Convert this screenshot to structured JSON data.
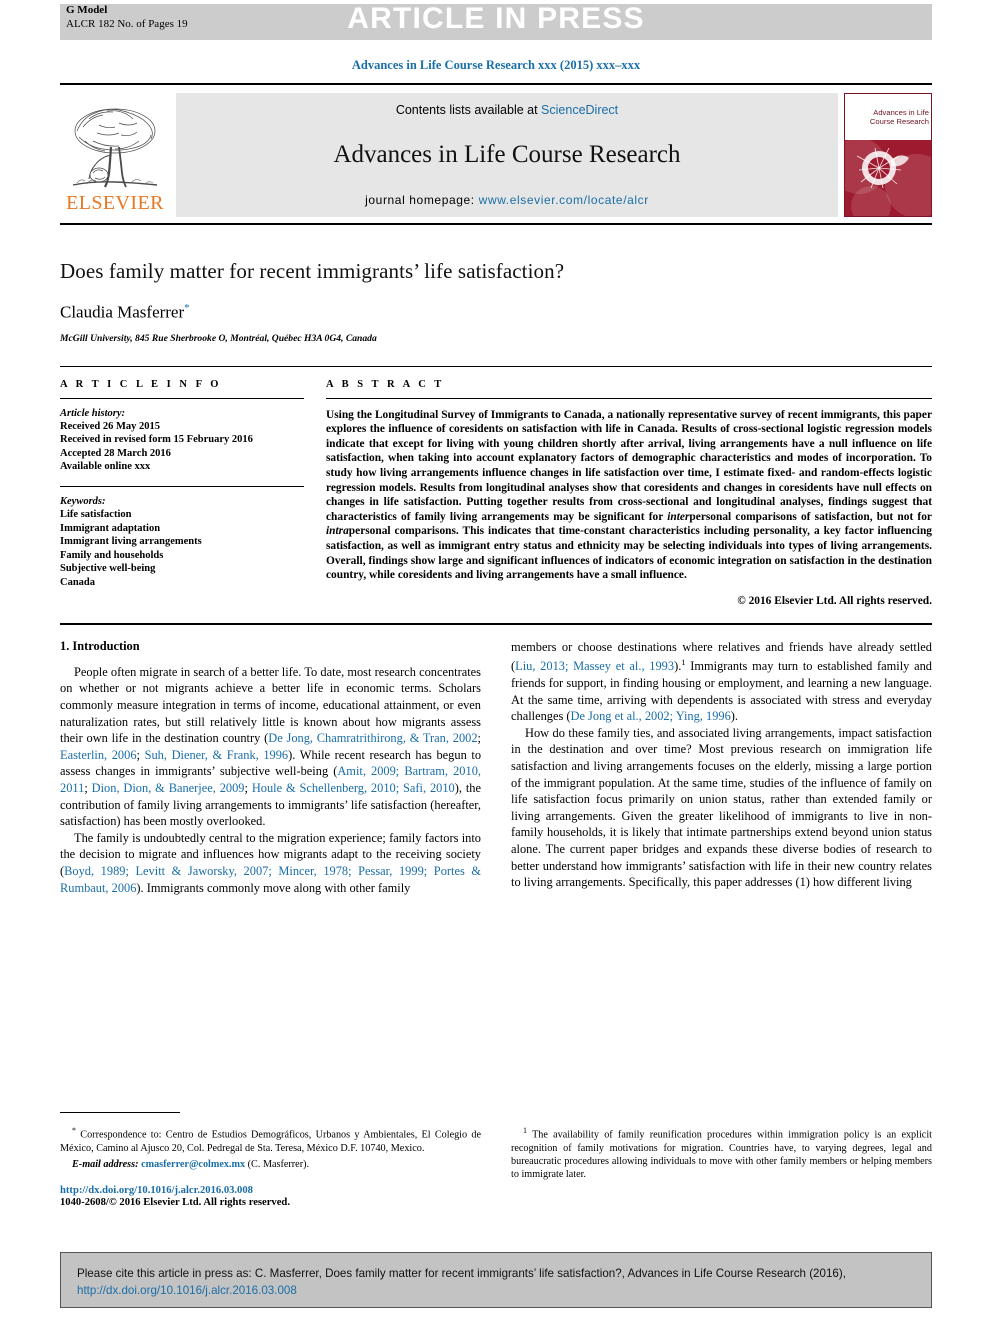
{
  "banner": {
    "article_in_press": "ARTICLE IN PRESS",
    "g_model": "G Model",
    "model_id": "ALCR 182 No. of Pages 19"
  },
  "journal_ref": "Advances in Life Course Research xxx (2015) xxx–xxx",
  "masthead": {
    "contents_prefix": "Contents lists available at ",
    "sciencedirect": "ScienceDirect",
    "journal_title": "Advances in Life Course Research",
    "homepage_label": "journal homepage: ",
    "homepage_url": "www.elsevier.com/locate/alcr",
    "publisher": "ELSEVIER",
    "cover_title": "Advances in Life Course Research"
  },
  "article": {
    "title": "Does family matter for recent immigrants’ life satisfaction?",
    "author": "Claudia Masferrer",
    "author_mark": "*",
    "affiliation": "McGill University, 845 Rue Sherbrooke O, Montréal, Québec H3A 0G4, Canada"
  },
  "article_info": {
    "heading": "A R T I C L E   I N F O",
    "history_label": "Article history:",
    "history": [
      "Received 26 May 2015",
      "Received in revised form 15 February 2016",
      "Accepted 28 March 2016",
      "Available online xxx"
    ],
    "keywords_label": "Keywords:",
    "keywords": [
      "Life satisfaction",
      "Immigrant adaptation",
      "Immigrant living arrangements",
      "Family and households",
      "Subjective well-being",
      "Canada"
    ]
  },
  "abstract": {
    "heading": "A B S T R A C T",
    "part1": "Using the Longitudinal Survey of Immigrants to Canada, a nationally representative survey of recent immigrants, this paper explores the influence of coresidents on satisfaction with life in Canada. Results of cross-sectional logistic regression models indicate that except for living with young children shortly after arrival, living arrangements have a null influence on life satisfaction, when taking into account explanatory factors of demographic characteristics and modes of incorporation. To study how living arrangements influence changes in life satisfaction over time, I estimate fixed- and random-effects logistic regression models. Results from longitudinal analyses show that coresidents and changes in coresidents have null effects on changes in life satisfaction. Putting together results from cross-sectional and longitudinal analyses, findings suggest that characteristics of family living arrangements may be significant for ",
    "italic1": "inter",
    "part2": "personal comparisons of satisfaction, but not for ",
    "italic2": "intra",
    "part3": "personal comparisons. This indicates that time-constant characteristics including personality, a key factor influencing satisfaction, as well as immigrant entry status and ethnicity may be selecting individuals into types of living arrangements. Overall, findings show large and significant influences of indicators of economic integration on satisfaction in the destination country, while coresidents and living arrangements have a small influence.",
    "copyright": "© 2016 Elsevier Ltd. All rights reserved."
  },
  "introduction": {
    "section_title": "1. Introduction",
    "left_p1_a": "People often migrate in search of a better life. To date, most research concentrates on whether or not migrants achieve a better life in economic terms. Scholars commonly measure integration in terms of income, educational attainment, or even naturalization rates, but still relatively little is known about how migrants assess their own life in the destination country (",
    "left_p1_cite1": "De Jong, Chamratrithirong, & Tran, 2002",
    "left_p1_b": "; ",
    "left_p1_cite2": "Easterlin, 2006",
    "left_p1_c": "; ",
    "left_p1_cite3": "Suh, Diener, & Frank, 1996",
    "left_p1_d": "). While recent research has begun to assess changes in immigrants’ subjective well-being (",
    "left_p1_cite4": "Amit, 2009; Bartram, 2010, 2011",
    "left_p1_e": "; ",
    "left_p1_cite5": "Dion, Dion, & Banerjee, 2009",
    "left_p1_f": "; ",
    "left_p1_cite6": "Houle & Schellenberg, 2010; Safi, 2010",
    "left_p1_g": "), the contribution of family living arrangements to immigrants’ life satisfaction (hereafter, satisfaction) has been mostly overlooked.",
    "left_p2_a": "The family is undoubtedly central to the migration experience; family factors into the decision to migrate and influences how migrants adapt to the receiving society (",
    "left_p2_cite1": "Boyd, 1989; Levitt & Jaworsky, 2007; Mincer, 1978; Pessar, 1999; Portes & Rumbaut, 2006",
    "left_p2_b": "). Immigrants commonly move along with other family",
    "right_p1_a": "members or choose destinations where relatives and friends have already settled (",
    "right_p1_cite1": "Liu, 2013; Massey et al., 1993",
    "right_p1_b": ").",
    "right_p1_sup": "1",
    "right_p1_c": " Immigrants may turn to established family and friends for support, in finding housing or employment, and learning a new language. At the same time, arriving with dependents is associated with stress and everyday challenges (",
    "right_p1_cite2": "De Jong et al., 2002; Ying, 1996",
    "right_p1_d": ").",
    "right_p2": "How do these family ties, and associated living arrangements, impact satisfaction in the destination and over time? Most previous research on immigration life satisfaction and living arrangements focuses on the elderly, missing a large portion of the immigrant population. At the same time, studies of the influence of family on life satisfaction focus primarily on union status, rather than extended family or living arrangements. Given the greater likelihood of immigrants to live in non-family households, it is likely that intimate partnerships extend beyond union status alone. The current paper bridges and expands these diverse bodies of research to better understand how immigrants’ satisfaction with life in their new country relates to living arrangements. Specifically, this paper addresses (1) how different living"
  },
  "footnotes": {
    "correspondence_mark": "*",
    "correspondence": "Correspondence to: Centro de Estudios Demográficos, Urbanos y Ambientales, El Colegio de México, Camino al Ajusco 20, Col. Pedregal de Sta. Teresa, México D.F. 10740, Mexico.",
    "email_label": "E-mail address:",
    "email": "cmasferrer@colmex.mx",
    "email_suffix": " (C. Masferrer).",
    "doi": "http://dx.doi.org/10.1016/j.alcr.2016.03.008",
    "issn": "1040-2608/© 2016 Elsevier Ltd. All rights reserved.",
    "right_mark": "1",
    "right_note": "The availability of family reunification procedures within immigration policy is an explicit recognition of family motivations for migration. Countries have, to varying degrees, legal and bureaucratic procedures allowing individuals to move with other family members or helping members to immigrate later."
  },
  "cite_box": {
    "prefix": "Please cite this article in press as: C. Masferrer, Does family matter for recent immigrants’ life satisfaction?, Advances in Life Course Research (2016), ",
    "link": "http://dx.doi.org/10.1016/j.alcr.2016.03.008"
  },
  "colors": {
    "link": "#1a6ea8",
    "elsevier_orange": "#E87722",
    "cover_red": "#9e1b2f",
    "banner_gray": "#cccccc",
    "masthead_gray": "#e6e6e6",
    "cite_box_gray": "#c3c3c3"
  }
}
